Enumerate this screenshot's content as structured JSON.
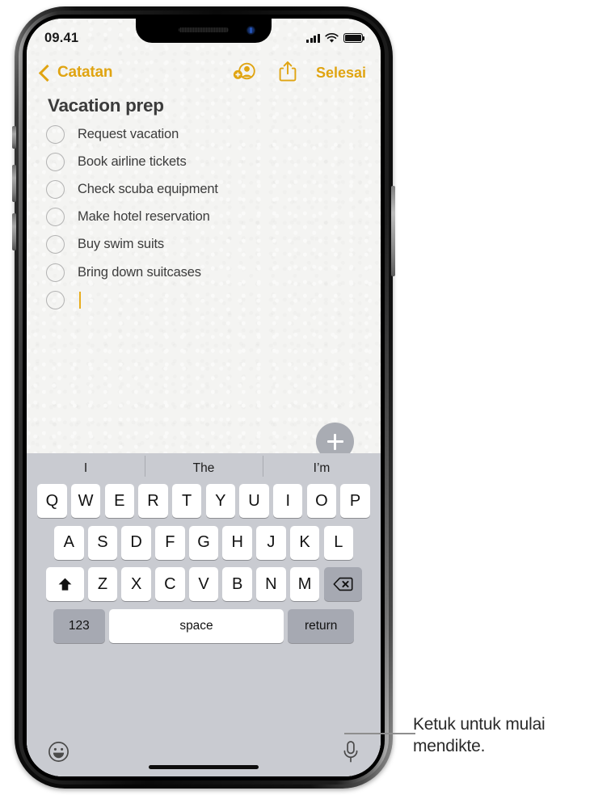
{
  "status_bar": {
    "time": "09.41",
    "cellular_icon": "signal-bars-icon",
    "wifi_icon": "wifi-icon",
    "battery_icon": "battery-full-icon"
  },
  "nav_bar": {
    "back_label": "Catatan",
    "back_icon": "chevron-left-icon",
    "collaborate_icon": "add-person-icon",
    "share_icon": "share-icon",
    "done_label": "Selesai"
  },
  "note": {
    "title": "Vacation prep",
    "checklist": [
      {
        "label": "Request vacation",
        "checked": false
      },
      {
        "label": "Book airline tickets",
        "checked": false
      },
      {
        "label": "Check scuba equipment",
        "checked": false
      },
      {
        "label": "Make hotel reservation",
        "checked": false
      },
      {
        "label": "Buy swim suits",
        "checked": false
      },
      {
        "label": "Bring down suitcases",
        "checked": false
      }
    ],
    "empty_item_has_cursor": true,
    "add_button_icon": "plus-icon"
  },
  "keyboard": {
    "suggestions": [
      "I",
      "The",
      "I’m"
    ],
    "row1": [
      "Q",
      "W",
      "E",
      "R",
      "T",
      "Y",
      "U",
      "I",
      "O",
      "P"
    ],
    "row2": [
      "A",
      "S",
      "D",
      "F",
      "G",
      "H",
      "J",
      "K",
      "L"
    ],
    "row3": [
      "Z",
      "X",
      "C",
      "V",
      "B",
      "N",
      "M"
    ],
    "shift_icon": "shift-arrow-icon",
    "delete_icon": "backspace-icon",
    "numbers_label": "123",
    "space_label": "space",
    "return_label": "return",
    "emoji_icon": "smiley-face-icon",
    "dictation_icon": "microphone-icon"
  },
  "callout": {
    "text": "Ketuk untuk mulai mendikte."
  },
  "colors": {
    "accent": "#e0a411",
    "cursor": "#e8ad1e",
    "keyboard_bg": "#c9cbd1",
    "key_bg": "#ffffff",
    "key_dark_bg": "#a6a9b2",
    "paper": "#f4f4f2",
    "fab": "#a9acb3"
  }
}
